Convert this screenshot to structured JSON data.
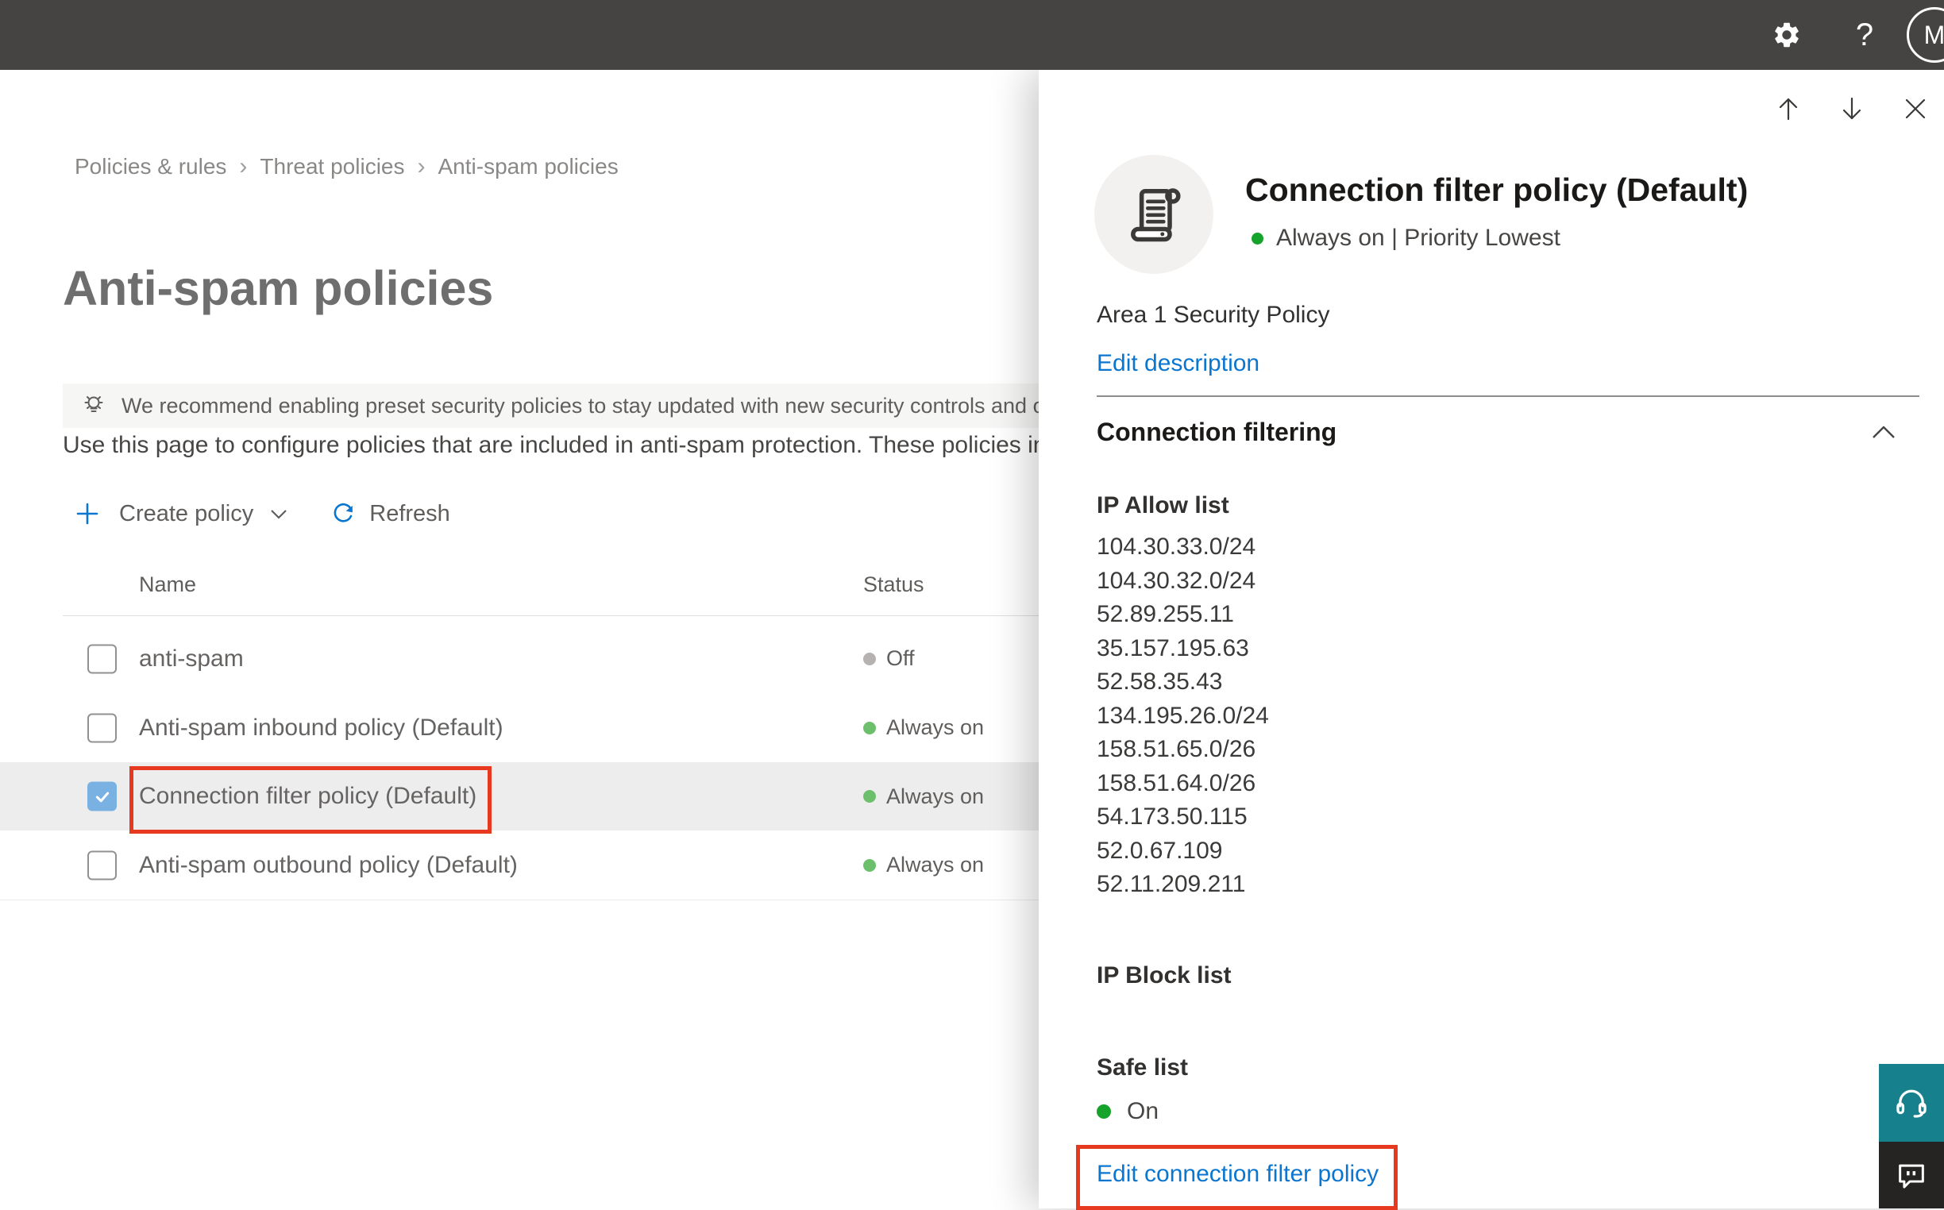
{
  "topbar": {
    "avatar_initial": "M",
    "help_glyph": "?"
  },
  "breadcrumb": {
    "items": [
      "Policies & rules",
      "Threat policies",
      "Anti-spam policies"
    ],
    "separator": "›"
  },
  "page": {
    "title": "Anti-spam policies",
    "banner_text": "We recommend enabling preset security policies to stay updated with new security controls and our recomme",
    "description": "Use this page to configure policies that are included in anti-spam protection. These policies include"
  },
  "toolbar": {
    "create_label": "Create policy",
    "refresh_label": "Refresh"
  },
  "table": {
    "columns": [
      "Name",
      "Status"
    ],
    "rows": [
      {
        "name": "anti-spam",
        "status": "Off",
        "checked": false,
        "selected": false
      },
      {
        "name": "Anti-spam inbound policy (Default)",
        "status": "Always on",
        "checked": false,
        "selected": false
      },
      {
        "name": "Connection filter policy (Default)",
        "status": "Always on",
        "checked": true,
        "selected": true,
        "annotated": true
      },
      {
        "name": "Anti-spam outbound policy (Default)",
        "status": "Always on",
        "checked": false,
        "selected": false
      }
    ]
  },
  "flyout": {
    "title": "Connection filter policy (Default)",
    "status_line": "Always on | Priority Lowest",
    "description": "Area 1 Security Policy",
    "edit_description_label": "Edit description",
    "section_title": "Connection filtering",
    "ip_allow": {
      "title": "IP Allow list",
      "items": [
        "104.30.33.0/24",
        "104.30.32.0/24",
        "52.89.255.11",
        "35.157.195.63",
        "52.58.35.43",
        "134.195.26.0/24",
        "158.51.65.0/26",
        "158.51.64.0/26",
        "54.173.50.115",
        "52.0.67.109",
        "52.11.209.211"
      ]
    },
    "ip_block_title": "IP Block list",
    "safe_list_title": "Safe list",
    "safe_list_status": "On",
    "edit_link_label": "Edit connection filter policy"
  },
  "colors": {
    "topbar": "#454442",
    "accent_blue": "#0b76d0",
    "annotation_red": "#e7391f",
    "status_green": "#6cc06c",
    "status_green_bright": "#16a32c",
    "status_off_gray": "#b5b2af",
    "help_teal": "#17808d",
    "checkbox_blue": "#79b1e3"
  }
}
